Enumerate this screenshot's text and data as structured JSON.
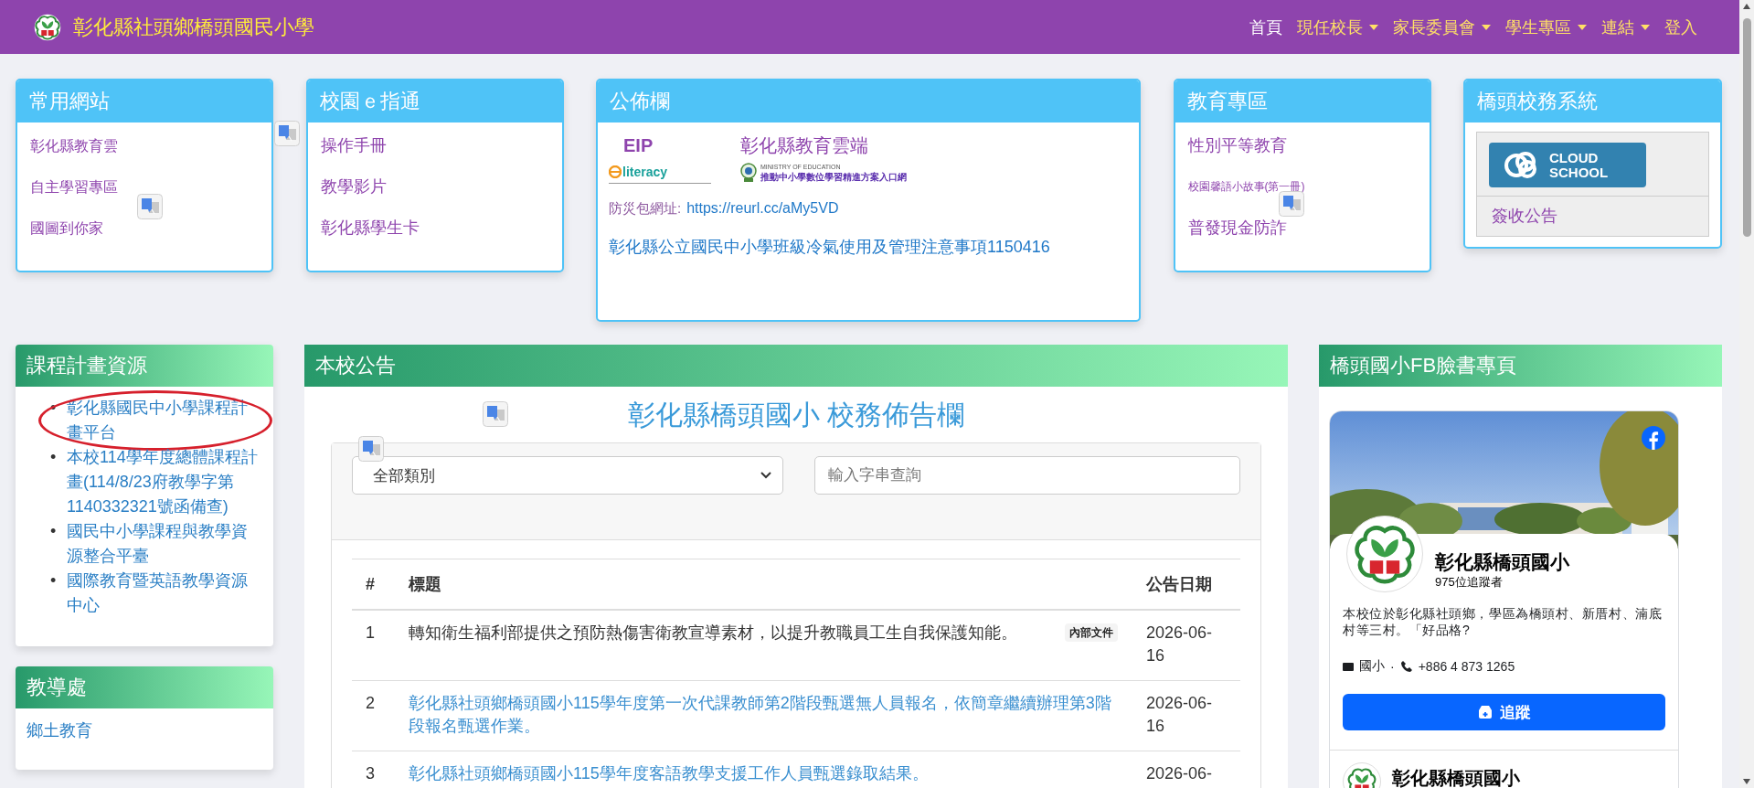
{
  "header": {
    "title": "彰化縣社頭鄉橋頭國民小學",
    "nav": [
      {
        "label": "首頁",
        "dropdown": false,
        "selected": true
      },
      {
        "label": "現任校長",
        "dropdown": true,
        "selected": false
      },
      {
        "label": "家長委員會",
        "dropdown": true,
        "selected": false
      },
      {
        "label": "學生專區",
        "dropdown": true,
        "selected": false
      },
      {
        "label": "連結",
        "dropdown": true,
        "selected": false
      },
      {
        "label": "登入",
        "dropdown": false,
        "selected": false
      }
    ]
  },
  "top_cards": [
    {
      "title": "常用網站",
      "kind": "links",
      "links": [
        {
          "text": "彰化縣教育雲",
          "kind": "normal"
        },
        {
          "text": "自主學習專區",
          "kind": "normal"
        },
        {
          "text": "國圖到你家",
          "kind": "normal"
        }
      ]
    },
    {
      "title": "校園ｅ指通",
      "kind": "links",
      "links": [
        {
          "text": "操作手冊",
          "kind": "large"
        },
        {
          "text": "教學影片",
          "kind": "large"
        },
        {
          "text": "彰化縣學生卡",
          "kind": "large"
        }
      ]
    },
    {
      "title": "公佈欄",
      "kind": "bulletin",
      "eip": "EIP",
      "cloud": "彰化縣教育雲端",
      "literacy": "literacy",
      "moe_caption": "MINISTRY OF EDUCATION",
      "moe": "推動中小學數位學習精進方案入口網",
      "disaster_label": "防災包網址:",
      "disaster_link": "https://reurl.cc/aMy5VD",
      "notice_link": "彰化縣公立國民中小學班級冷氣使用及管理注意事項1150416"
    },
    {
      "title": "教育專區",
      "kind": "links",
      "links": [
        {
          "text": "性別平等教育",
          "kind": "large"
        },
        {
          "text": "校園馨語小故事(第一冊)",
          "kind": "small"
        },
        {
          "text": "普發現金防詐",
          "kind": "large"
        }
      ]
    },
    {
      "title": "橋頭校務系統",
      "kind": "system",
      "logo": "CLOUD SCHOOL",
      "link": "簽收公告"
    }
  ],
  "curriculum": {
    "title": "課程計畫資源",
    "bullet": "•",
    "items": [
      {
        "text": "彰化縣國民中小學課程計畫平台",
        "circled": true
      },
      {
        "text": "本校114學年度總體課程計畫(114/8/23府教學字第1140332321號函備查)",
        "circled": false
      },
      {
        "text": "國民中小學課程與教學資源整合平臺",
        "circled": false
      },
      {
        "text": "國際教育暨英語教學資源中心",
        "circled": false
      }
    ]
  },
  "guidance": {
    "title": "教導處",
    "links": [
      "鄉土教育"
    ]
  },
  "announcements": {
    "title": "本校公告",
    "board_title": "彰化縣橋頭國小 校務佈告欄",
    "category": {
      "value": "全部類別"
    },
    "search": {
      "placeholder": "輸入字串查詢"
    },
    "columns": [
      "#",
      "標題",
      "公告日期"
    ],
    "rows": [
      {
        "no": "1",
        "title": "轉知衛生福利部提供之預防熱傷害衛教宣導素材，以提升教職員工生自我保護知能。",
        "badge": "內部文件",
        "link": false,
        "date": "2026-06-16"
      },
      {
        "no": "2",
        "title": "彰化縣社頭鄉橋頭國小115學年度第一次代課教師第2階段甄選無人員報名，依簡章繼續辦理第3階段報名甄選作業。",
        "link": true,
        "date": "2026-06-16"
      },
      {
        "no": "3",
        "title": "彰化縣社頭鄉橋頭國小115學年度客語教學支援工作人員甄選錄取結果。",
        "link": true,
        "date": "2026-06-"
      }
    ]
  },
  "facebook": {
    "title": "橋頭國小FB臉書專頁",
    "name": "彰化縣橋頭國小",
    "followers": "975位追蹤者",
    "about": "本校位於彰化縣社頭鄉，學區為橋頭村、新厝村、湳底村等三村。「好品格?",
    "category": "國小",
    "separator": "·",
    "phone": "+886 4 873 1265",
    "follow": "追蹤",
    "post_author": "彰化縣橋頭國小"
  }
}
